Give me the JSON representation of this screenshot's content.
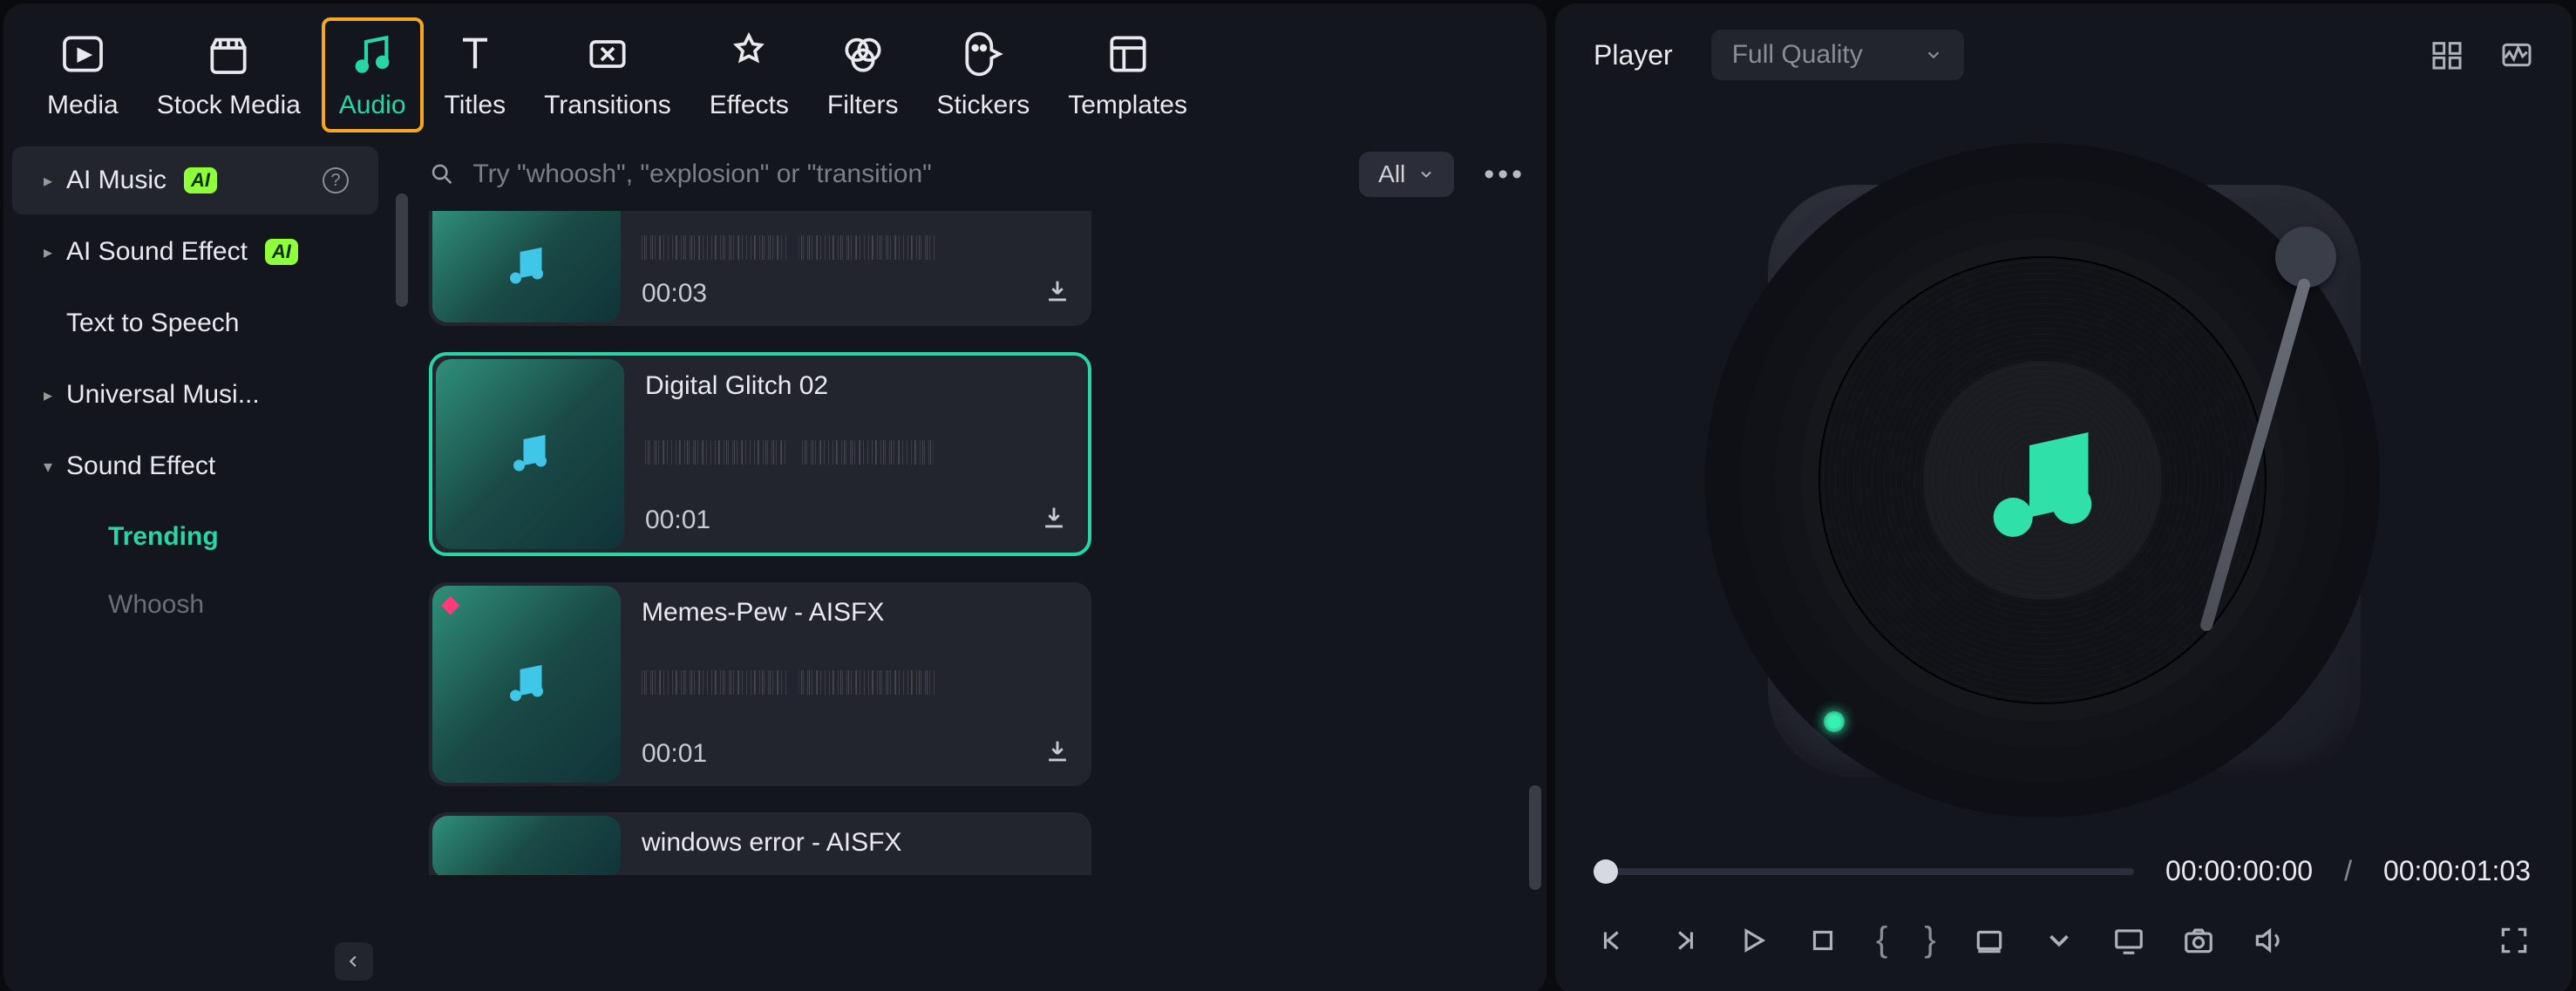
{
  "tabs": {
    "media": "Media",
    "stock": "Stock Media",
    "audio": "Audio",
    "titles": "Titles",
    "transitions": "Transitions",
    "effects": "Effects",
    "filters": "Filters",
    "stickers": "Stickers",
    "templates": "Templates"
  },
  "sidebar": {
    "ai_music": "AI Music",
    "ai_badge": "AI",
    "ai_sound_effect": "AI Sound Effect",
    "tts": "Text to Speech",
    "universal_music": "Universal Musi...",
    "sound_effect": "Sound Effect",
    "trending": "Trending",
    "whoosh": "Whoosh"
  },
  "search": {
    "placeholder": "Try \"whoosh\", \"explosion\" or \"transition\""
  },
  "filter": {
    "all": "All"
  },
  "cards": {
    "c0_duration": "00:03",
    "c1_title": "Digital Glitch 02",
    "c1_duration": "00:01",
    "c2_title": "Memes-Pew - AISFX",
    "c2_duration": "00:01",
    "c3_title": "windows error - AISFX"
  },
  "player": {
    "title": "Player",
    "quality": "Full Quality",
    "current": "00:00:00:00",
    "total": "00:00:01:03"
  }
}
